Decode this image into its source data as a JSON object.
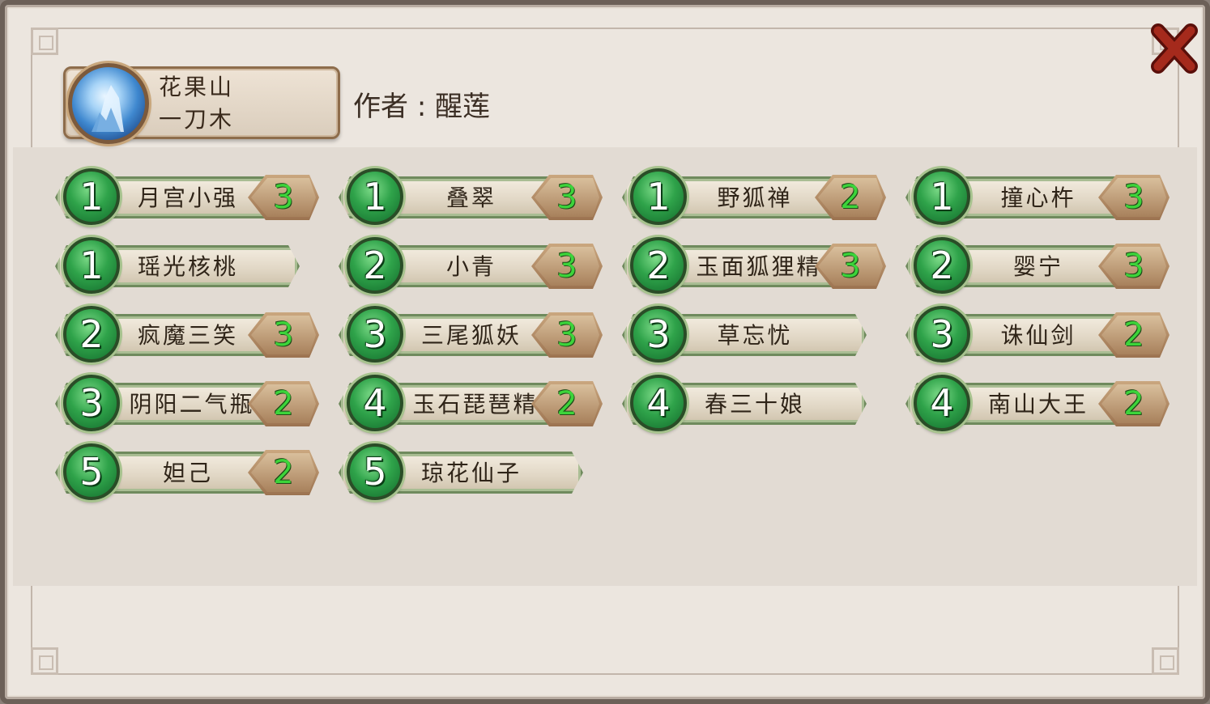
{
  "header": {
    "region": "花果山",
    "player": "一刀木",
    "author_label": "作者",
    "author_sep": ":",
    "author_name": "醒莲"
  },
  "cards": [
    {
      "tier": "1",
      "name": "月宫小强",
      "count": "3"
    },
    {
      "tier": "1",
      "name": "叠翠",
      "count": "3"
    },
    {
      "tier": "1",
      "name": "野狐禅",
      "count": "2"
    },
    {
      "tier": "1",
      "name": "撞心杵",
      "count": "3"
    },
    {
      "tier": "1",
      "name": "瑶光核桃",
      "count": null
    },
    {
      "tier": "2",
      "name": "小青",
      "count": "3"
    },
    {
      "tier": "2",
      "name": "玉面狐狸精",
      "count": "3"
    },
    {
      "tier": "2",
      "name": "婴宁",
      "count": "3"
    },
    {
      "tier": "2",
      "name": "疯魔三笑",
      "count": "3"
    },
    {
      "tier": "3",
      "name": "三尾狐妖",
      "count": "3"
    },
    {
      "tier": "3",
      "name": "草忘忧",
      "count": null
    },
    {
      "tier": "3",
      "name": "诛仙剑",
      "count": "2"
    },
    {
      "tier": "3",
      "name": "阴阳二气瓶",
      "count": "2"
    },
    {
      "tier": "4",
      "name": "玉石琵琶精",
      "count": "2"
    },
    {
      "tier": "4",
      "name": "春三十娘",
      "count": null
    },
    {
      "tier": "4",
      "name": "南山大王",
      "count": "2"
    },
    {
      "tier": "5",
      "name": "妲己",
      "count": "2"
    },
    {
      "tier": "5",
      "name": "琼花仙子",
      "count": null
    }
  ],
  "colors": {
    "tier_badge": "#2fa34a",
    "count_text": "#3cd43a",
    "close_icon": "#8a1a12"
  },
  "icons": {
    "close": "close-icon",
    "avatar": "mountain-avatar-icon"
  }
}
